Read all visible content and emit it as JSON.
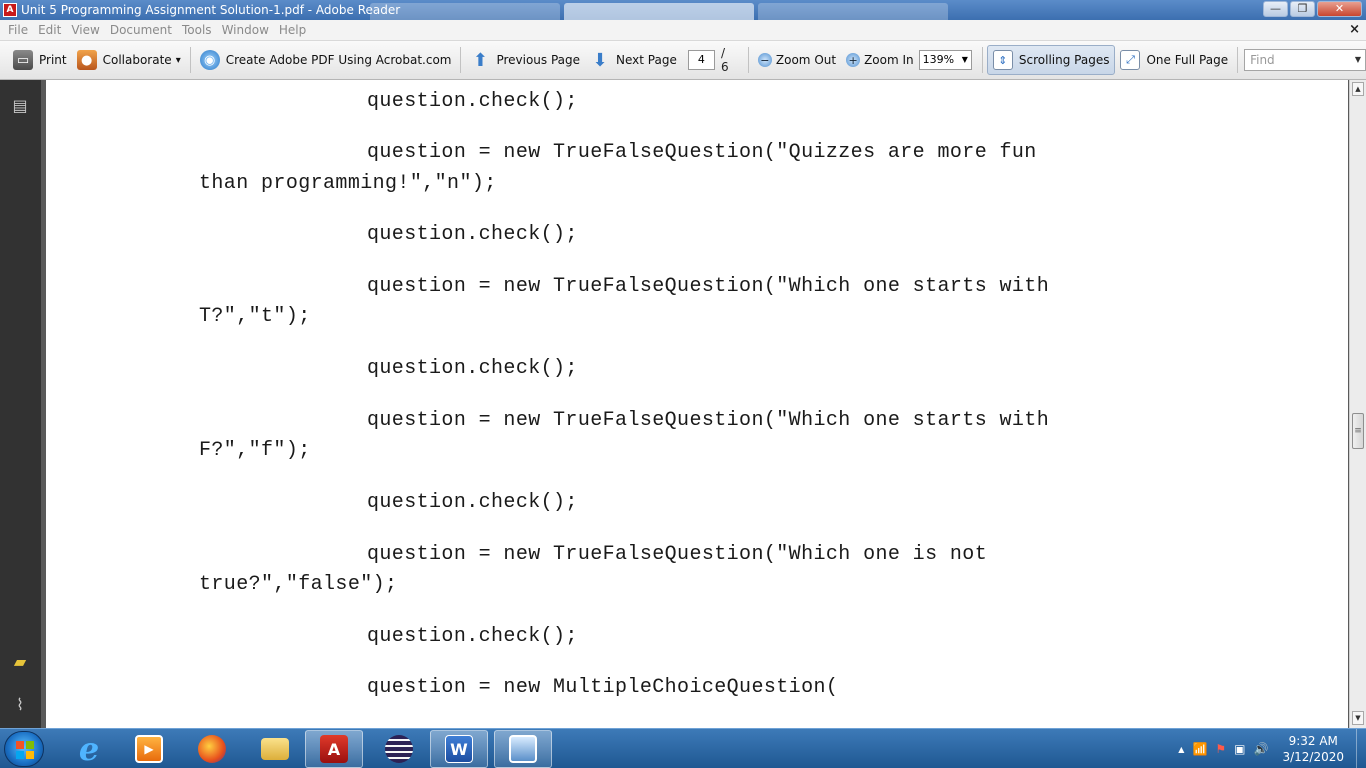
{
  "window": {
    "title": "Unit 5 Programming Assignment Solution-1.pdf - Adobe Reader",
    "app_icon_label": "A",
    "controls": {
      "minimize": "—",
      "maximize": "❐",
      "close": "✕"
    }
  },
  "menu": {
    "items": [
      "File",
      "Edit",
      "View",
      "Document",
      "Tools",
      "Window",
      "Help"
    ],
    "close": "×"
  },
  "toolbar": {
    "print": "Print",
    "collaborate": "Collaborate",
    "collaborate_arrow": "▾",
    "create_pdf": "Create Adobe PDF Using Acrobat.com",
    "previous_page": "Previous Page",
    "next_page": "Next Page",
    "current_page": "4",
    "total_pages": "/ 6",
    "zoom_out": "Zoom Out",
    "zoom_in": "Zoom In",
    "zoom_level": "139%",
    "zoom_arrow": "▼",
    "scrolling_pages": "Scrolling Pages",
    "one_full_page": "One Full Page",
    "find_placeholder": "Find",
    "find_arrow": "▼"
  },
  "document": {
    "lines": [
      "question.check();",
      "question = new TrueFalseQuestion(\"Quizzes are more fun",
      "than programming!\",\"n\");",
      "question.check();",
      "question = new TrueFalseQuestion(\"Which one starts with",
      "T?\",\"t\");",
      "question.check();",
      "question = new TrueFalseQuestion(\"Which one starts with",
      "F?\",\"f\");",
      "question.check();",
      "question = new TrueFalseQuestion(\"Which one is not",
      "true?\",\"false\");",
      "question.check();",
      "question = new MultipleChoiceQuestion("
    ]
  },
  "scrollbar": {
    "up": "▲",
    "down": "▼",
    "grip": "≡"
  },
  "taskbar": {
    "apps": [
      "internet-explorer",
      "media-player",
      "firefox",
      "file-explorer",
      "adobe-reader",
      "eclipse",
      "microsoft-word",
      "image-viewer"
    ],
    "word_letter": "W",
    "reader_letter": "A",
    "ie_letter": "e",
    "clock_time": "9:32 AM",
    "clock_date": "3/12/2020",
    "tray_arrow": "▲",
    "signal": "📶",
    "volume": "🔊"
  }
}
